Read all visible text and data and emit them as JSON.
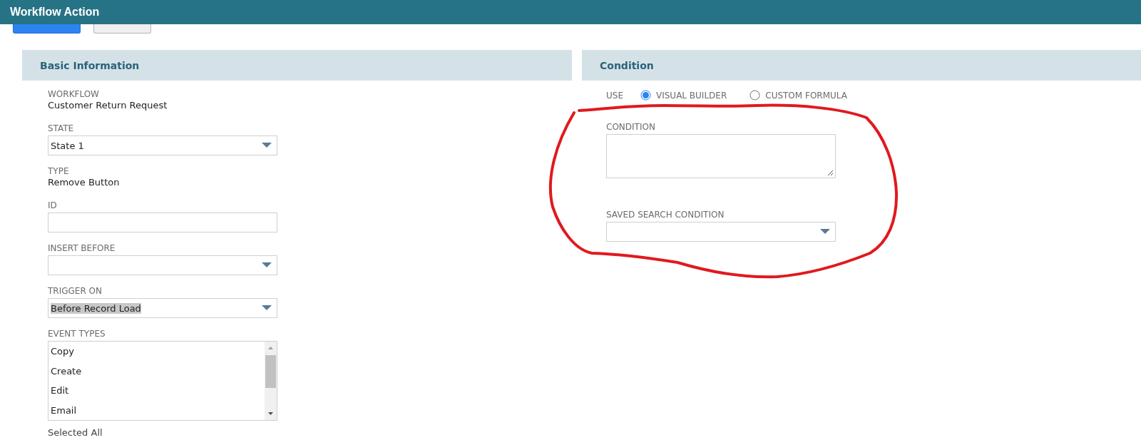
{
  "window": {
    "title": "Workflow Action"
  },
  "toolbar_buttons": [
    {
      "kind": "primary"
    },
    {
      "kind": "secondary"
    }
  ],
  "basic_information": {
    "title": "Basic Information",
    "fields": [
      {
        "kind": "text",
        "label": "WORKFLOW",
        "value": "Customer Return Request"
      },
      {
        "kind": "select",
        "label": "STATE",
        "value": "State 1",
        "highlighted": false
      },
      {
        "kind": "text",
        "label": "TYPE",
        "value": "Remove Button"
      },
      {
        "kind": "input",
        "label": "ID"
      },
      {
        "kind": "select",
        "label": "INSERT BEFORE"
      },
      {
        "kind": "select",
        "label": "TRIGGER ON",
        "value": "Before Record Load",
        "highlighted": true
      },
      {
        "kind": "list",
        "label": "EVENT TYPES",
        "items": [
          "Copy",
          "Create",
          "Edit",
          "Email"
        ]
      }
    ],
    "note": "Selected All"
  },
  "condition": {
    "title": "Condition",
    "use_label": "USE",
    "options": [
      {
        "label": "VISUAL BUILDER",
        "selected": true
      },
      {
        "label": "CUSTOM FORMULA",
        "selected": false
      }
    ],
    "condition_label": "CONDITION",
    "saved_search_label": "SAVED SEARCH CONDITION"
  }
}
